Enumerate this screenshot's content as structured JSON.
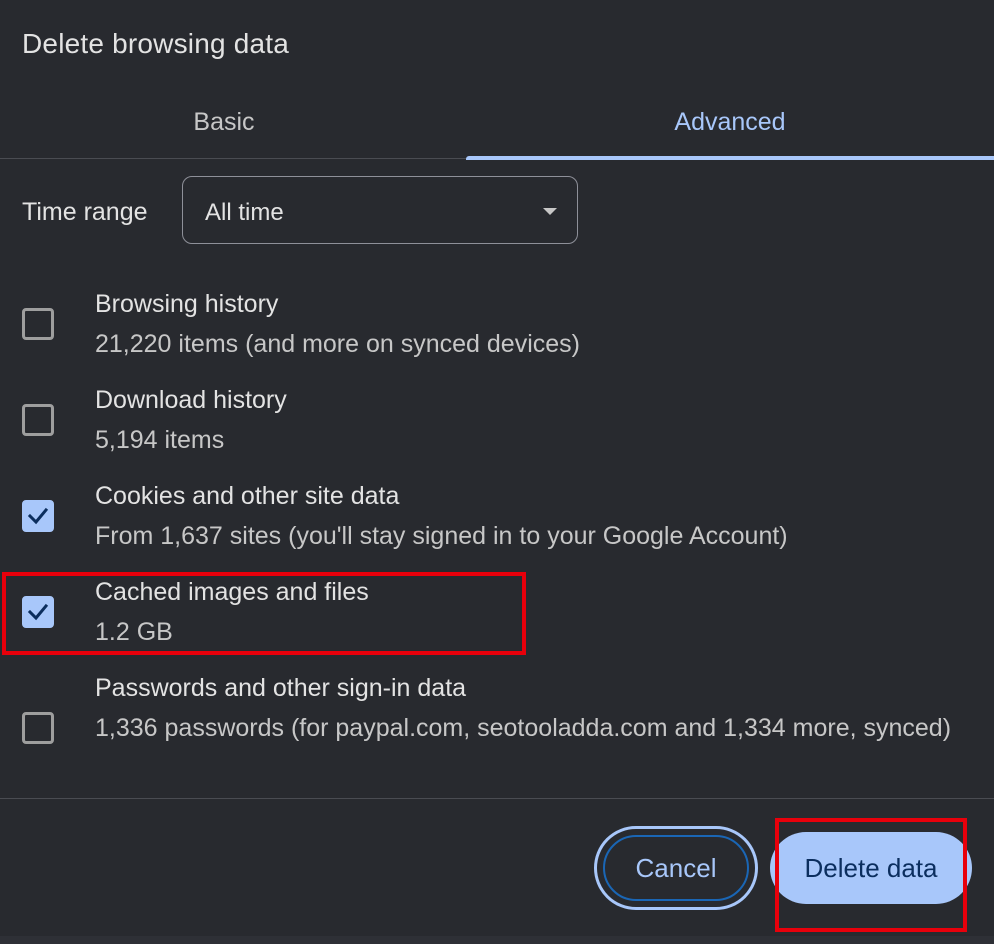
{
  "dialog": {
    "title": "Delete browsing data"
  },
  "tabs": [
    {
      "label": "Basic",
      "active": false
    },
    {
      "label": "Advanced",
      "active": true
    }
  ],
  "time_range": {
    "label": "Time range",
    "value": "All time"
  },
  "items": [
    {
      "title": "Browsing history",
      "subtitle": "21,220 items (and more on synced devices)",
      "checked": false
    },
    {
      "title": "Download history",
      "subtitle": "5,194 items",
      "checked": false
    },
    {
      "title": "Cookies and other site data",
      "subtitle": "From 1,637 sites (you'll stay signed in to your Google Account)",
      "checked": true
    },
    {
      "title": "Cached images and files",
      "subtitle": "1.2 GB",
      "checked": true
    },
    {
      "title": "Passwords and other sign-in data",
      "subtitle": "1,336 passwords (for paypal.com, seotooladda.com and 1,334 more, synced)",
      "checked": false
    }
  ],
  "buttons": {
    "cancel": "Cancel",
    "delete": "Delete data"
  },
  "colors": {
    "background": "#282a2f",
    "accent": "#a8c7fa",
    "highlight": "#e8000b"
  }
}
